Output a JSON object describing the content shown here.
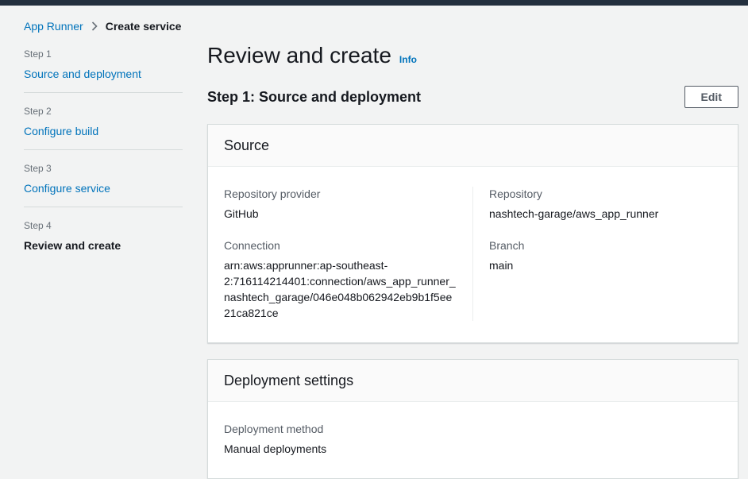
{
  "breadcrumb": {
    "items": [
      "App Runner",
      "Create service"
    ]
  },
  "sidebar": {
    "steps": [
      {
        "step": "Step 1",
        "label": "Source and deployment",
        "current": false
      },
      {
        "step": "Step 2",
        "label": "Configure build",
        "current": false
      },
      {
        "step": "Step 3",
        "label": "Configure service",
        "current": false
      },
      {
        "step": "Step 4",
        "label": "Review and create",
        "current": true
      }
    ]
  },
  "main": {
    "title": "Review and create",
    "info_label": "Info",
    "section_heading": "Step 1: Source and deployment",
    "edit_button_label": "Edit",
    "source_card": {
      "title": "Source",
      "columns": [
        {
          "fields": [
            {
              "label": "Repository provider",
              "value": "GitHub"
            },
            {
              "label": "Connection",
              "value": "arn:aws:apprunner:ap-southeast-2:716114214401:connection/aws_app_runner_nashtech_garage/046e048b062942eb9b1f5ee21ca821ce"
            }
          ]
        },
        {
          "fields": [
            {
              "label": "Repository",
              "value": "nashtech-garage/aws_app_runner"
            },
            {
              "label": "Branch",
              "value": "main"
            }
          ]
        }
      ]
    },
    "deployment_card": {
      "title": "Deployment settings",
      "fields": [
        {
          "label": "Deployment method",
          "value": "Manual deployments"
        }
      ]
    }
  },
  "colors": {
    "top_bar": "#232f3e",
    "page_background": "#f2f3f3",
    "link_blue": "#0073bb",
    "text_primary": "#16191f",
    "text_secondary": "#545b64",
    "text_muted": "#687078",
    "card_background": "#ffffff",
    "card_header_background": "#fafafa",
    "card_border": "#d5dbdb",
    "divider": "#eaeded",
    "button_border": "#545b64"
  }
}
